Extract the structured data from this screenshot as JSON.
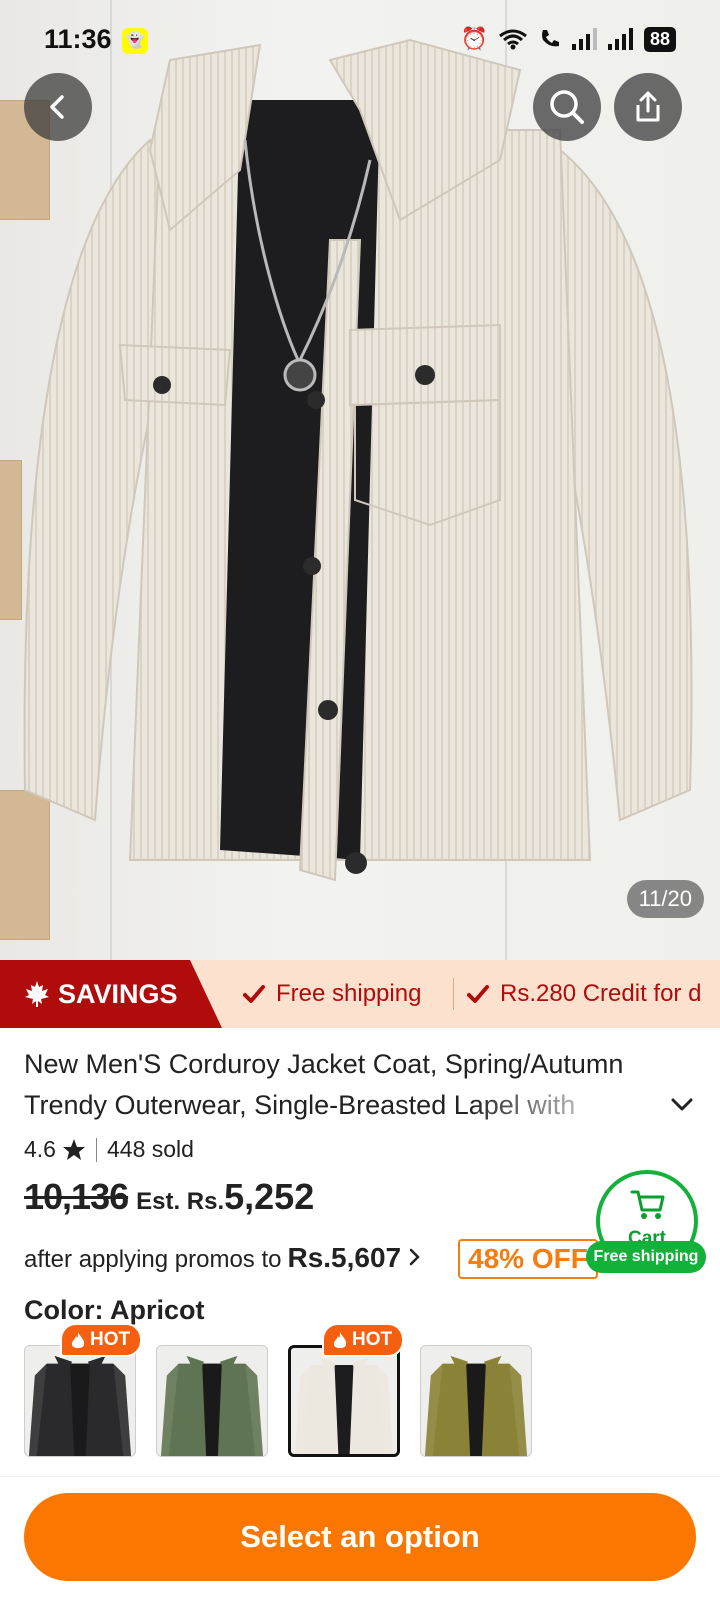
{
  "status_bar": {
    "time": "11:36",
    "battery": "88"
  },
  "gallery": {
    "counter": "11/20"
  },
  "strip": {
    "savings_label": "SAVINGS",
    "perks": [
      "Free shipping",
      "Rs.280 Credit for d"
    ]
  },
  "product": {
    "title": "New Men'S Corduroy Jacket Coat, Spring/Autumn Trendy Outerwear, Single-Breasted Lapel with",
    "rating": "4.6",
    "sold": "448 sold",
    "original_price": "10,136",
    "est_label": "Est. Rs.",
    "est_price": "5,252",
    "promo_prefix": "after applying promos to",
    "promo_price": "Rs.5,607",
    "discount": "48% OFF"
  },
  "cart": {
    "label": "Cart",
    "badge": "Free shipping"
  },
  "color": {
    "label": "Color: Apricot",
    "swatches": [
      {
        "name": "Black",
        "hot": "HOT",
        "color": "#2a2a2c"
      },
      {
        "name": "Green",
        "hot": "",
        "color": "#5f7452"
      },
      {
        "name": "Apricot",
        "hot": "HOT",
        "color": "#ece8df"
      },
      {
        "name": "Olive",
        "hot": "",
        "color": "#8a8236"
      }
    ],
    "selected_index": 2
  },
  "cta": {
    "label": "Select an option"
  },
  "colors": {
    "accent": "#fb7701",
    "savings_red": "#b00c0c",
    "cart_green": "#13b13a"
  }
}
